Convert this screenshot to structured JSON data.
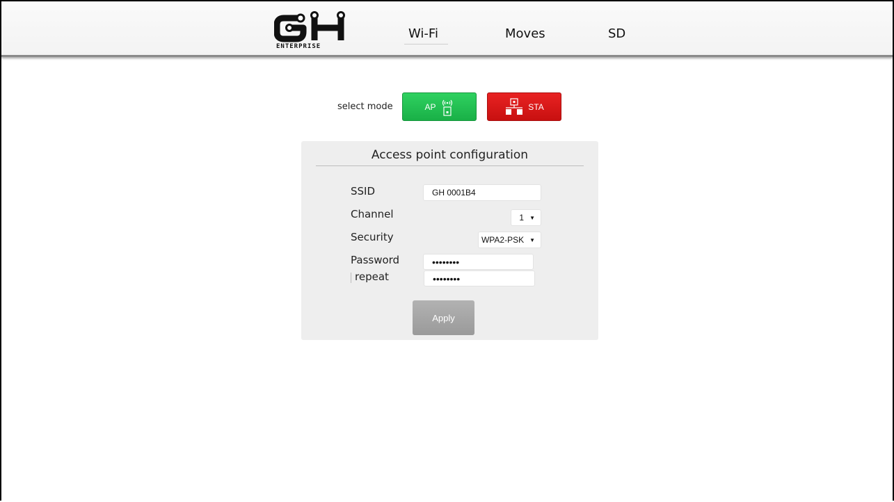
{
  "header": {
    "logo_text": "ENTERPRISE",
    "nav": {
      "wifi": "Wi-Fi",
      "moves": "Moves",
      "sd": "SD"
    }
  },
  "mode": {
    "label": "select mode",
    "ap_label": "AP",
    "sta_label": "STA",
    "ap_color": "#22c453",
    "sta_color": "#d91616"
  },
  "panel": {
    "title": "Access point configuration",
    "labels": {
      "ssid": "SSID",
      "channel": "Channel",
      "security": "Security",
      "password": "Password",
      "repeat": "repeat"
    },
    "values": {
      "ssid": "GH 0001B4",
      "channel": "1",
      "security": "WPA2-PSK",
      "password": "••••••••",
      "repeat": "••••••••"
    },
    "apply_label": "Apply"
  },
  "icons": {
    "ap": "wifi-antenna-icon",
    "sta": "network-stations-icon",
    "select_caret": "caret-down-icon"
  }
}
